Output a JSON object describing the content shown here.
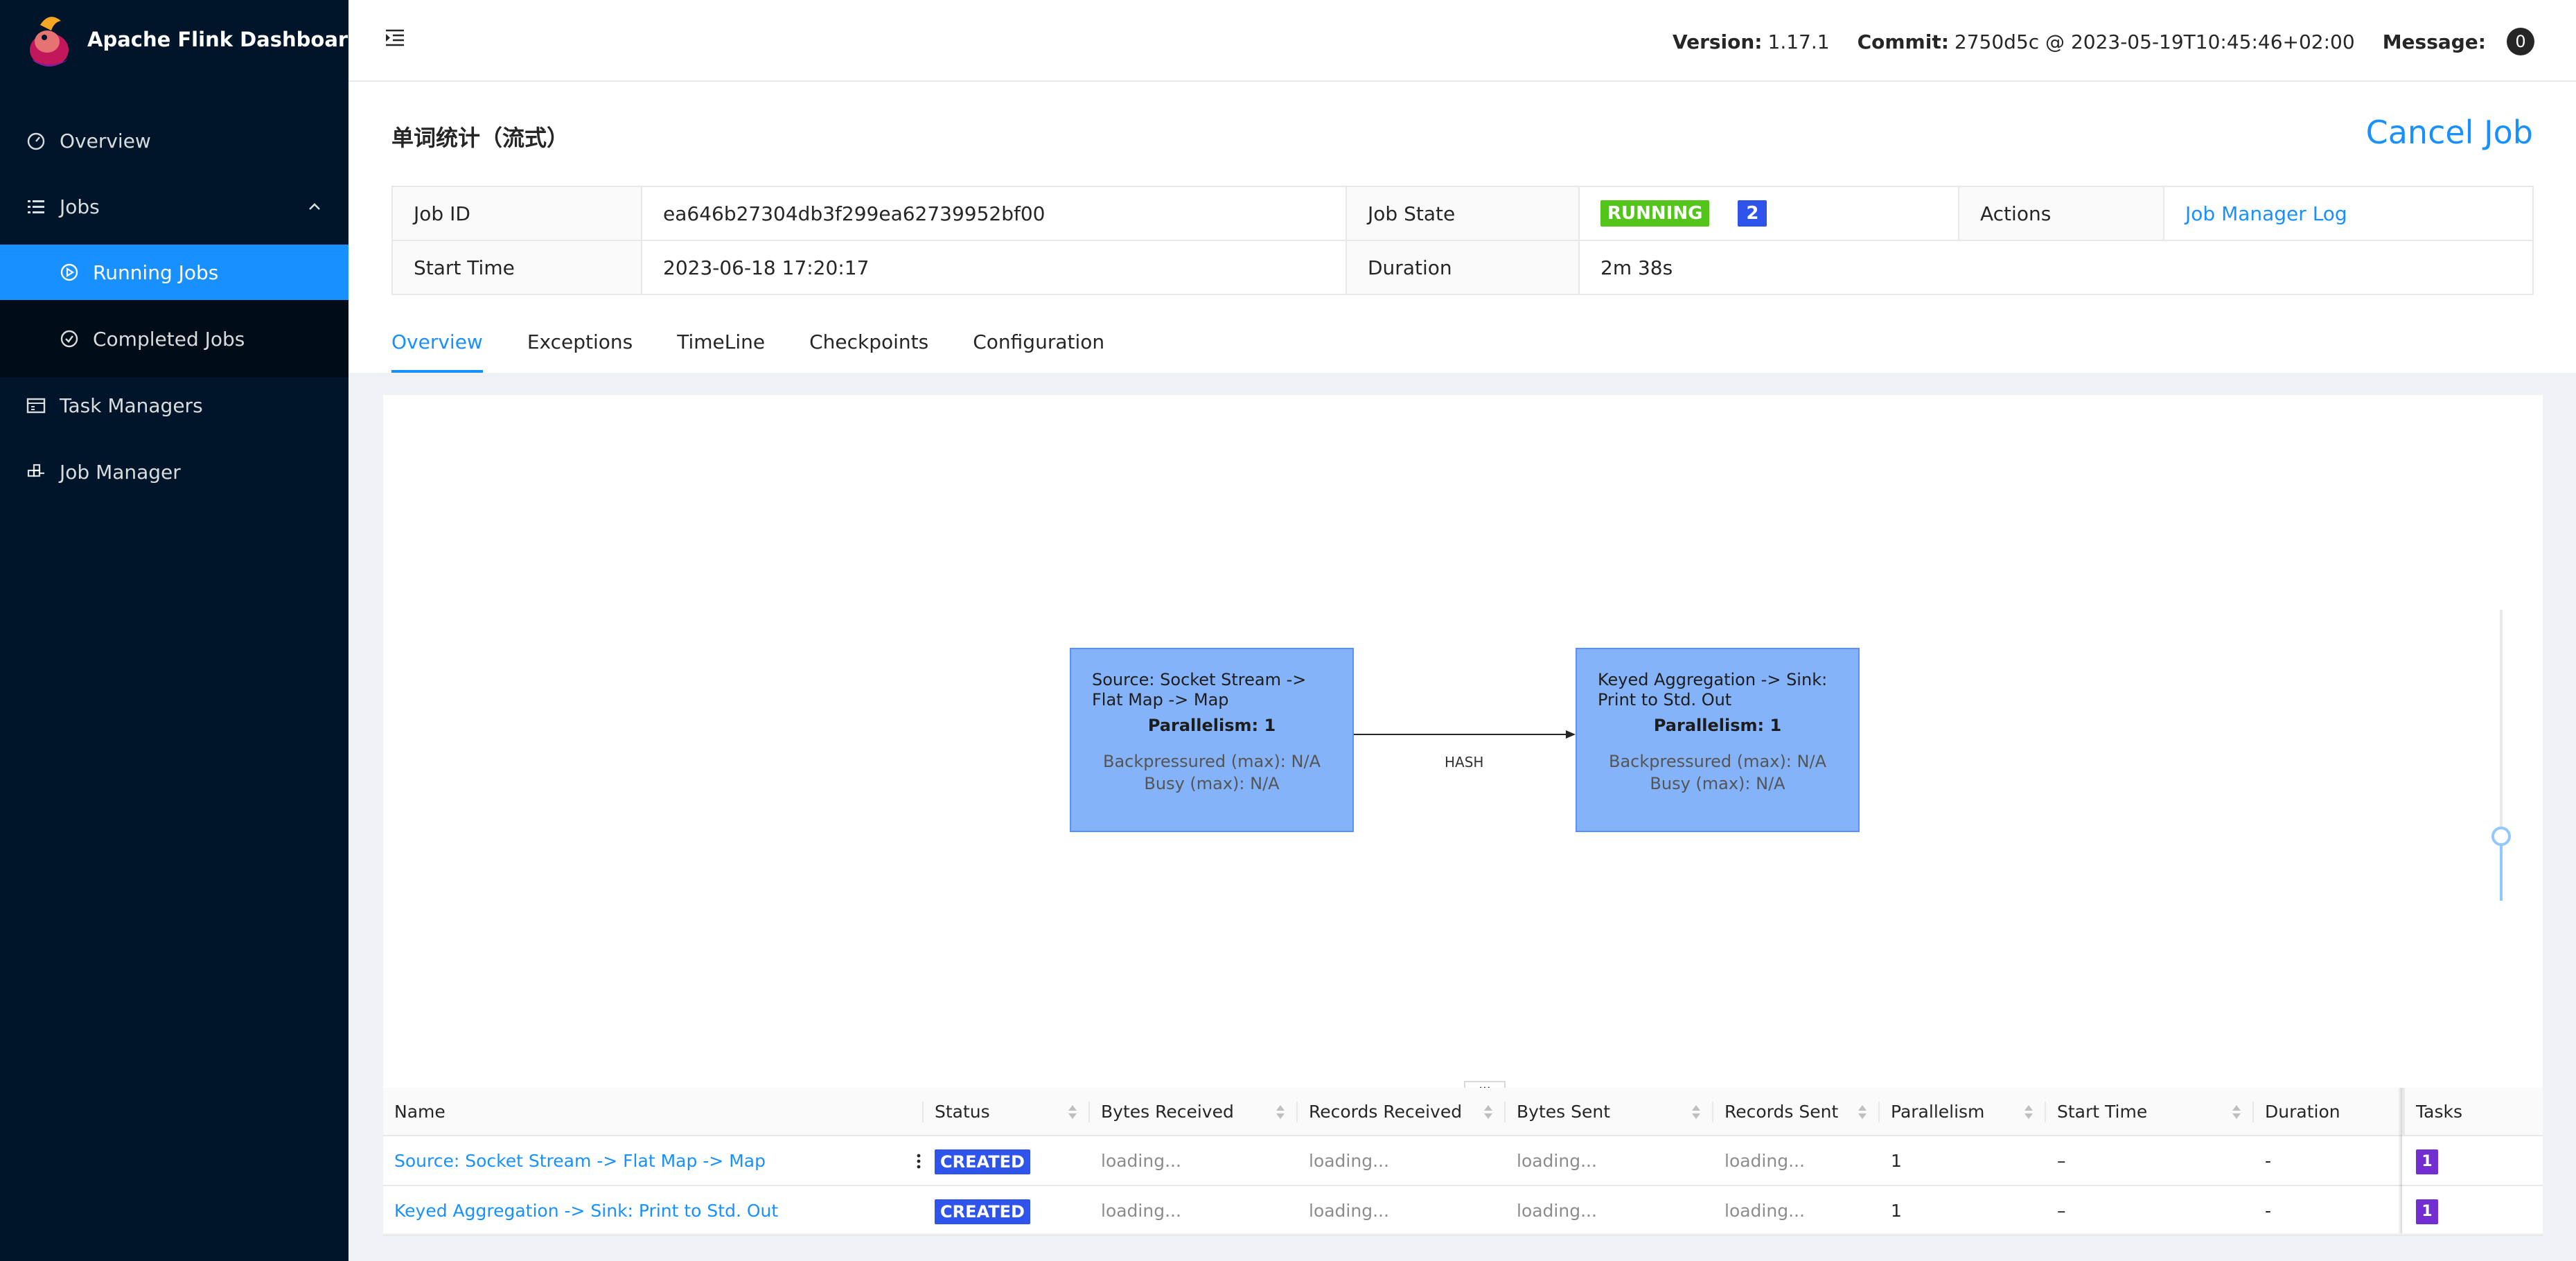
{
  "app": {
    "title": "Apache Flink Dashboard"
  },
  "sidebar": {
    "items": [
      {
        "label": "Overview",
        "icon": "dashboard-icon"
      },
      {
        "label": "Jobs",
        "icon": "unordered-list-icon"
      },
      {
        "label": "Running Jobs",
        "icon": "play-circle-icon"
      },
      {
        "label": "Completed Jobs",
        "icon": "check-circle-icon"
      },
      {
        "label": "Task Managers",
        "icon": "schedule-icon"
      },
      {
        "label": "Job Manager",
        "icon": "build-icon"
      }
    ]
  },
  "header": {
    "version_label": "Version:",
    "version": "1.17.1",
    "commit_label": "Commit:",
    "commit": "2750d5c @ 2023-05-19T10:45:46+02:00",
    "message_label": "Message:",
    "message_count": "0"
  },
  "job": {
    "title": "单词统计（流式）",
    "cancel_label": "Cancel Job",
    "id_label": "Job ID",
    "id": "ea646b27304db3f299ea62739952bf00",
    "state_label": "Job State",
    "state": "RUNNING",
    "state_count": "2",
    "actions_label": "Actions",
    "action_link": "Job Manager Log",
    "start_label": "Start Time",
    "start": "2023-06-18 17:20:17",
    "duration_label": "Duration",
    "duration": "2m 38s"
  },
  "tabs": [
    "Overview",
    "Exceptions",
    "TimeLine",
    "Checkpoints",
    "Configuration"
  ],
  "graph": {
    "nodes": [
      {
        "name": "Source: Socket Stream -> Flat Map -> Map",
        "parallelism": "Parallelism: 1",
        "backpressure": "Backpressured (max): N/A",
        "busy": "Busy (max): N/A"
      },
      {
        "name": "Keyed Aggregation -> Sink: Print to Std. Out",
        "parallelism": "Parallelism: 1",
        "backpressure": "Backpressured (max): N/A",
        "busy": "Busy (max): N/A"
      }
    ],
    "edge_label": "HASH",
    "resize_handle": "...",
    "colors": {
      "node_fill": "#84b3f9",
      "node_border": "#5b8ff9"
    }
  },
  "vertex_table": {
    "columns": [
      "Name",
      "Status",
      "Bytes Received",
      "Records Received",
      "Bytes Sent",
      "Records Sent",
      "Parallelism",
      "Start Time",
      "Duration",
      "Tasks"
    ],
    "rows": [
      {
        "name": "Source: Socket Stream -> Flat Map -> Map",
        "status": "CREATED",
        "bytes_received": "loading...",
        "records_received": "loading...",
        "bytes_sent": "loading...",
        "records_sent": "loading...",
        "parallelism": "1",
        "start_time": "–",
        "duration": "-",
        "tasks": "1"
      },
      {
        "name": "Keyed Aggregation -> Sink: Print to Std. Out",
        "status": "CREATED",
        "bytes_received": "loading...",
        "records_received": "loading...",
        "bytes_sent": "loading...",
        "records_sent": "loading...",
        "parallelism": "1",
        "start_time": "–",
        "duration": "-",
        "tasks": "1"
      }
    ]
  },
  "colors": {
    "sidebar_bg": "#001529",
    "accent": "#1890ff",
    "running": "#52c41a",
    "created": "#2f54eb",
    "tasks": "#722ed1"
  }
}
